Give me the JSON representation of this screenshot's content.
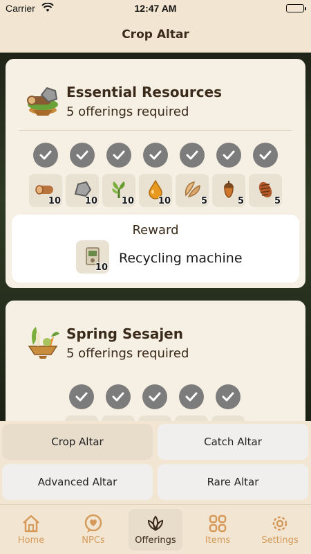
{
  "status": {
    "carrier": "Carrier",
    "time": "12:47 AM"
  },
  "header": {
    "title": "Crop Altar"
  },
  "altars": [
    {
      "title": "Essential Resources",
      "subtitle": "5 offerings required",
      "icon": "wood-stone-altar-icon",
      "checks": 7,
      "items": [
        {
          "name": "log-icon",
          "count": "10"
        },
        {
          "name": "stone-icon",
          "count": "10"
        },
        {
          "name": "fiber-plant-icon",
          "count": "10"
        },
        {
          "name": "sap-drop-icon",
          "count": "10"
        },
        {
          "name": "seed-pod-icon",
          "count": "5"
        },
        {
          "name": "acorn-icon",
          "count": "5"
        },
        {
          "name": "pinecone-icon",
          "count": "5"
        }
      ],
      "reward": {
        "label": "Reward",
        "item": "Recycling machine",
        "count": "10",
        "icon": "recycling-machine-icon"
      }
    },
    {
      "title": "Spring Sesajen",
      "subtitle": "5 offerings required",
      "icon": "vegetable-offering-icon",
      "checks": 5
    }
  ],
  "altar_buttons": [
    {
      "label": "Crop Altar",
      "active": true
    },
    {
      "label": "Catch Altar",
      "active": false
    },
    {
      "label": "Advanced Altar",
      "active": false
    },
    {
      "label": "Rare Altar",
      "active": false
    }
  ],
  "tabs": [
    {
      "label": "Home",
      "icon": "house-icon"
    },
    {
      "label": "NPCs",
      "icon": "heart-bubble-icon"
    },
    {
      "label": "Offerings",
      "icon": "lotus-icon",
      "active": true
    },
    {
      "label": "Items",
      "icon": "grid-icon"
    },
    {
      "label": "Settings",
      "icon": "gear-icon"
    }
  ],
  "colors": {
    "accent": "#d59a5a",
    "card": "#f6efe3",
    "check": "#7c7c7c"
  }
}
